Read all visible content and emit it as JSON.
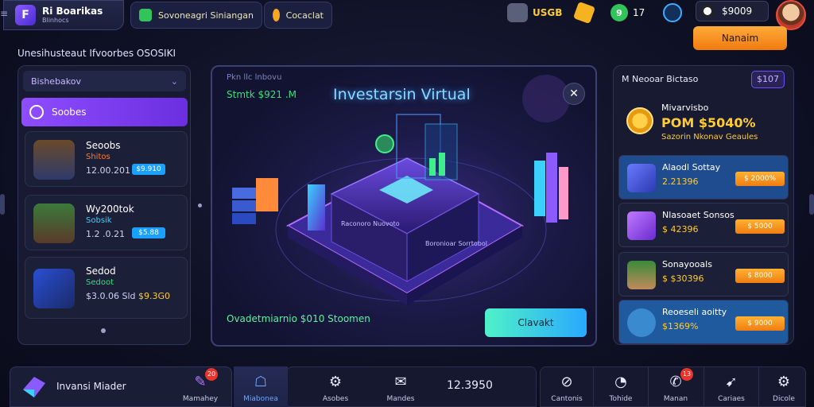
{
  "brand": {
    "title": "Ri Boarikas",
    "subtitle": "Blinhocs"
  },
  "top_tabs": [
    {
      "label": "Sovoneagri Siniangan",
      "icon": "chart-icon",
      "color": "#31c45a"
    },
    {
      "label": "Cocaclat",
      "icon": "coin-icon",
      "color": "#f5a623"
    }
  ],
  "stats": {
    "s1": "USGB",
    "s2": "9",
    "s3": "17",
    "coins": "$9009"
  },
  "orange_button": "Nanaim",
  "section_title": "Unesihusteaut Ifvoorbes OSOSIKI",
  "left_panel": {
    "header": "Bishebakov",
    "selected": "Soobes",
    "cards": [
      {
        "name": "Seoobs",
        "sub": "Shitos",
        "sub_color": "#ff7a2e",
        "value": "12.00.201",
        "tag": "$9.910"
      },
      {
        "name": "Wy200tok",
        "sub": "Sobsik",
        "sub_color": "#3ad1ff",
        "value": "1.2 .0.21",
        "tag": "$5.88"
      },
      {
        "name": "Sedod",
        "sub": "Sedoot",
        "sub_color": "#34e07a",
        "value": "$3.0.06 Sld",
        "value2": "$9.3G0",
        "tag": ""
      }
    ]
  },
  "center": {
    "small": "Pkn llc lnbovu",
    "green": "Stmtk $921 .M",
    "title": "Investarsin Virtual",
    "bottom_text": "Ovadetmiarnio $010 Stoomen",
    "button": "Clavakt",
    "box_label_1": "Raconoro Nuovoto",
    "box_label_2": "Boronioar Sorrtobol"
  },
  "right_panel": {
    "title": "M Neooar Bictaso",
    "badge": "$107",
    "feature": {
      "line1": "Mivarvisbo",
      "line2": "POM $5040%",
      "line3": "Sazorin Nkonav Geaules"
    },
    "cards": [
      {
        "name": "Alaodl Sottay",
        "value": "2.21396",
        "tag": "$ 2000%",
        "bg": "#1f4b8f"
      },
      {
        "name": "Nlasoaet Sonsos",
        "value": "$ 42396",
        "tag": "$ 5000",
        "bg": "#1c1f38"
      },
      {
        "name": "Sonayooals",
        "value": "$ $30396",
        "tag": "$ 8000",
        "bg": "#1c1f38"
      },
      {
        "name": "Reoeseli aoitty",
        "value": "$1369%",
        "tag": "$ 9000",
        "bg": "#1f5a9f"
      }
    ]
  },
  "bottom": {
    "app_name": "Invansi Miader",
    "nav": [
      {
        "label": "Mamahey",
        "icon": "pencil-icon",
        "glyph": "✎",
        "badge": "20"
      },
      {
        "label": "Miabonea",
        "icon": "user-icon",
        "glyph": "☖",
        "badge": ""
      },
      {
        "label": "Asobes",
        "icon": "gear-icon",
        "glyph": "⚙",
        "badge": ""
      },
      {
        "label": "Mandes",
        "icon": "chat-icon",
        "glyph": "✉",
        "badge": ""
      }
    ],
    "counter": "12.3950",
    "nav_right": [
      {
        "label": "Cantonis",
        "icon": "compass-icon",
        "glyph": "⊘",
        "badge": ""
      },
      {
        "label": "Tohide",
        "icon": "clock-icon",
        "glyph": "◔",
        "badge": ""
      },
      {
        "label": "Manan",
        "icon": "megaphone-icon",
        "glyph": "✆",
        "badge": "13"
      },
      {
        "label": "Cariaes",
        "icon": "rocket-icon",
        "glyph": "➹",
        "badge": ""
      },
      {
        "label": "Dicole",
        "icon": "settings-icon",
        "glyph": "⚙",
        "badge": ""
      }
    ]
  }
}
